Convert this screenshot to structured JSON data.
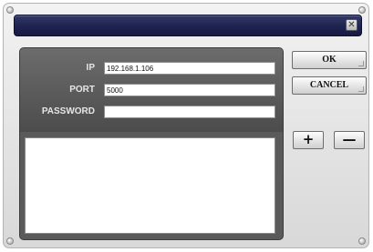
{
  "dialog": {
    "close_icon": "close-icon"
  },
  "form": {
    "ip": {
      "label": "IP",
      "value": "192.168.1.106"
    },
    "port": {
      "label": "PORT",
      "value": "5000"
    },
    "password": {
      "label": "PASSWORD",
      "value": ""
    }
  },
  "buttons": {
    "ok_label": "OK",
    "cancel_label": "CANCEL",
    "add_symbol": "+",
    "remove_symbol": "—"
  },
  "server_list": {
    "items": []
  }
}
